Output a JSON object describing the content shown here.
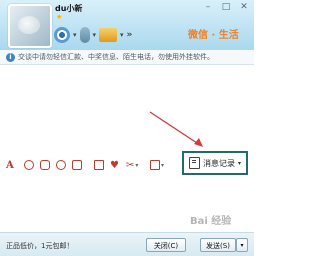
{
  "header": {
    "nickname": "du小新",
    "brand": "微信 · 生活",
    "window_controls": [
      "–",
      "□",
      "✕"
    ]
  },
  "notice": {
    "text": "交谈中请勿轻信汇款、中奖信息、陌生电话，勿使用外挂软件。"
  },
  "format_toolbar": {
    "font_glyph": "A",
    "history_label": "消息记录",
    "history_dropdown": "▾"
  },
  "bottom_bar": {
    "promo_text": "正品低价，1元包邮！",
    "close_label": "关闭(C)",
    "send_label": "发送(S)",
    "send_dropdown": "▾"
  },
  "watermark": "Bai 经验",
  "colors": {
    "accent": "#f17f23",
    "highlight_border": "#1f6b6e",
    "arrow": "#d63a3a",
    "icon_red": "#c0392b"
  }
}
